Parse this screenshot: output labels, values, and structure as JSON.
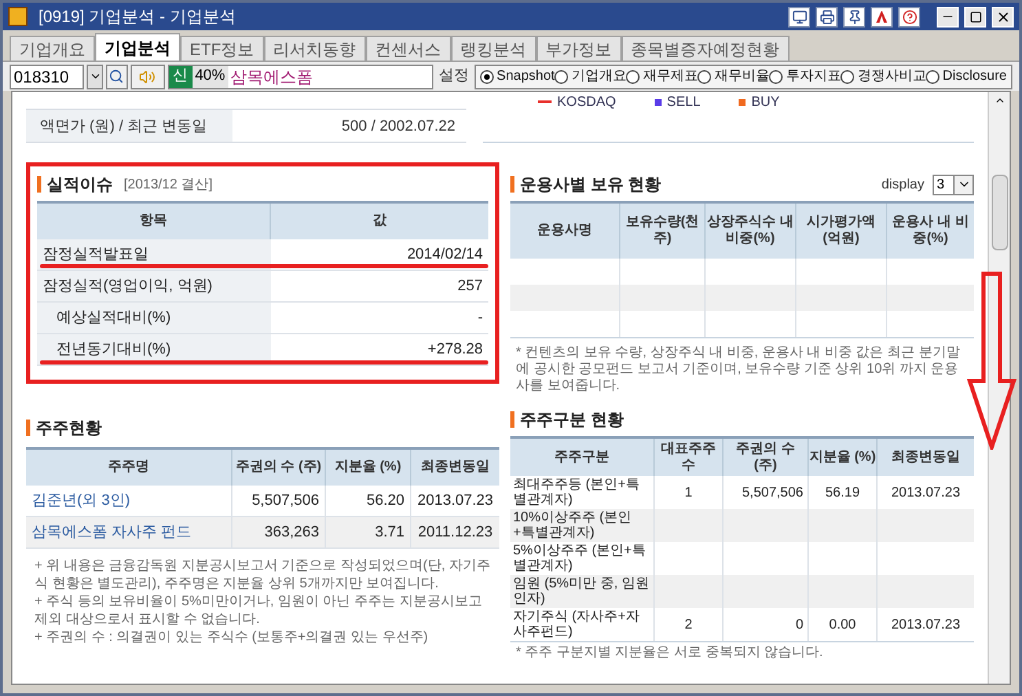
{
  "window": {
    "title": "[0919] 기업분석 - 기업분석"
  },
  "tabs": [
    {
      "label": "기업개요",
      "selected": false
    },
    {
      "label": "기업분석",
      "selected": true
    },
    {
      "label": "ETF정보",
      "selected": false
    },
    {
      "label": "리서치동향",
      "selected": false
    },
    {
      "label": "컨센서스",
      "selected": false
    },
    {
      "label": "랭킹분석",
      "selected": false
    },
    {
      "label": "부가정보",
      "selected": false
    },
    {
      "label": "종목별증자예정현황",
      "selected": false
    }
  ],
  "toolbar": {
    "code": "018310",
    "badge": "신",
    "ratio": "40%",
    "name": "삼목에스폼",
    "settings_label": "설정",
    "views": [
      {
        "label": "Snapshot",
        "selected": true
      },
      {
        "label": "기업개요",
        "selected": false
      },
      {
        "label": "재무제표",
        "selected": false
      },
      {
        "label": "재무비율",
        "selected": false
      },
      {
        "label": "투자지표",
        "selected": false
      },
      {
        "label": "경쟁사비교",
        "selected": false
      },
      {
        "label": "Disclosure",
        "selected": false
      }
    ]
  },
  "top_table": [
    {
      "label": "액면가 (원) / 최근 변동일",
      "value": "500 / 2002.07.22"
    }
  ],
  "legend": [
    {
      "label": "KOSDAQ",
      "kind": "line",
      "color": "#e8302c"
    },
    {
      "label": "SELL",
      "kind": "square",
      "color": "#5a3ce8"
    },
    {
      "label": "BUY",
      "kind": "square",
      "color": "#f06a20"
    }
  ],
  "earnings": {
    "title": "실적이슈",
    "subtitle": "[2013/12 결산]",
    "columns": [
      "항목",
      "값"
    ],
    "rows": [
      {
        "label": "잠정실적발표일",
        "value": "2014/02/14",
        "indented": false
      },
      {
        "label": "잠정실적(영업이익, 억원)",
        "value": "257",
        "indented": false
      },
      {
        "label": "예상실적대비(%)",
        "value": "-",
        "indented": true
      },
      {
        "label": "전년동기대비(%)",
        "value": "+278.28",
        "indented": true
      }
    ]
  },
  "funds": {
    "title": "운용사별 보유 현황",
    "display_label": "display",
    "display_value": "3",
    "columns": [
      "운용사명",
      "보유수량(천주)",
      "상장주식수 내 비중(%)",
      "시가평가액 (억원)",
      "운용사 내 비중(%)"
    ],
    "note": "* 컨텐츠의 보유 수량, 상장주식 내 비중, 운용사 내 비중 값은 최근 분기말에 공시한 공모펀드 보고서 기준이며, 보유수량 기준 상위 10위 까지 운용사를 보여줍니다."
  },
  "shareholders": {
    "title": "주주현황",
    "columns": [
      "주주명",
      "주권의 수 (주)",
      "지분율 (%)",
      "최종변동일"
    ],
    "rows": [
      [
        "김준년(외 3인)",
        "5,507,506",
        "56.20",
        "2013.07.23"
      ],
      [
        "삼목에스폼 자사주 펀드",
        "363,263",
        "3.71",
        "2011.12.23"
      ]
    ],
    "notes": [
      "+ 위 내용은 금융감독원 지분공시보고서 기준으로 작성되었으며(단, 자기주식 현황은 별도관리), 주주명은 지분율 상위 5개까지만 보여집니다.",
      "+ 주식 등의 보유비율이 5%미만이거나, 임원이 아닌 주주는 지분공시보고 제외 대상으로서 표시할 수 없습니다.",
      "+ 주권의 수 : 의결권이 있는 주식수 (보통주+의결권 있는 우선주)"
    ]
  },
  "shareholder_types": {
    "title": "주주구분 현황",
    "columns": [
      "주주구분",
      "대표주주 수",
      "주권의 수 (주)",
      "지분율 (%)",
      "최종변동일"
    ],
    "rows": [
      [
        "최대주주등 (본인+특별관계자)",
        "1",
        "5,507,506",
        "56.19",
        "2013.07.23"
      ],
      [
        "10%이상주주 (본인+특별관계자)",
        "",
        "",
        "",
        ""
      ],
      [
        "5%이상주주 (본인+특별관계자)",
        "",
        "",
        "",
        ""
      ],
      [
        "임원 (5%미만 중, 임원인자)",
        "",
        "",
        "",
        ""
      ],
      [
        "자기주식 (자사주+자사주펀드)",
        "2",
        "0",
        "0.00",
        "2013.07.23"
      ]
    ],
    "note": "* 주주 구분지별 지분율은 서로 중복되지 않습니다."
  }
}
